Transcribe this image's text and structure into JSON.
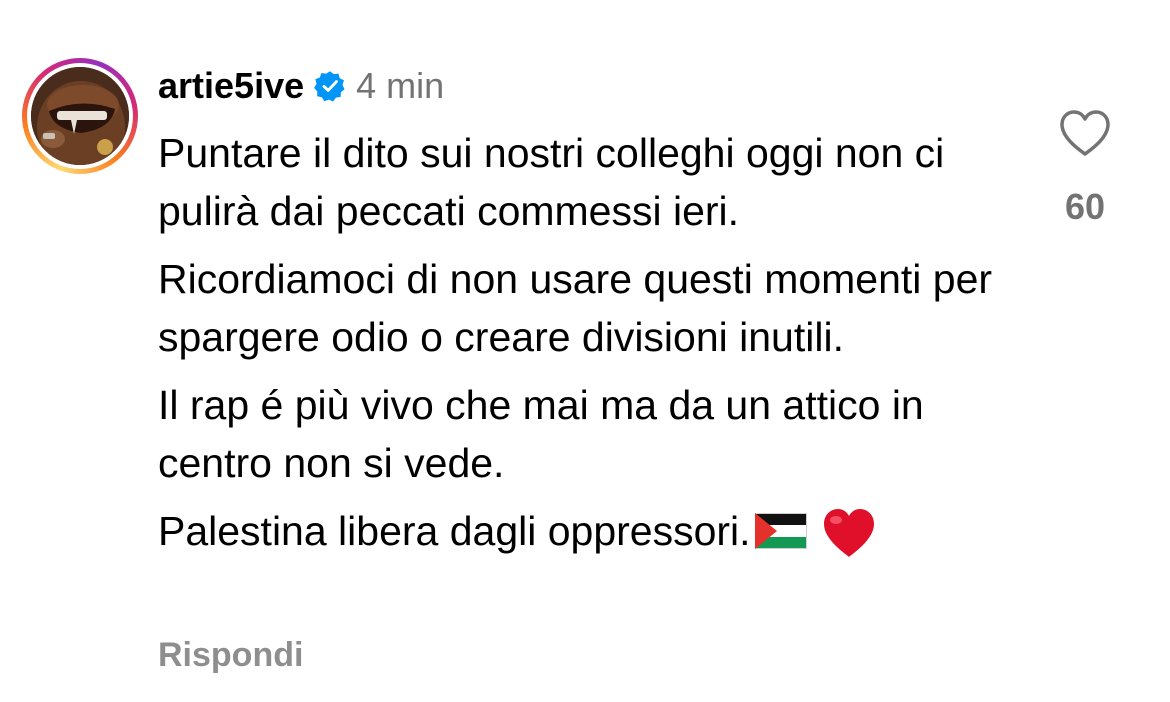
{
  "comment": {
    "username": "artie5ive",
    "time": "4 min",
    "paragraphs": [
      {
        "text": "Puntare il dito sui nostri colleghi oggi non ci pulirà dai peccati commessi ieri."
      },
      {
        "text": "Ricordiamoci di non usare questi momenti per spargere odio o creare divisioni inutili."
      },
      {
        "text": "Il rap é più vivo che mai ma da un attico in centro non si vede."
      },
      {
        "text": "Palestina libera dagli oppressori."
      }
    ],
    "emojis": [
      "palestine-flag",
      "red-heart"
    ],
    "reply_label": "Rispondi",
    "like_count": "60"
  },
  "colors": {
    "verified_badge": "#0095f6",
    "secondary_text": "#737373",
    "reply_text": "#8e8e8e",
    "heart_emoji": "#e0102b"
  }
}
